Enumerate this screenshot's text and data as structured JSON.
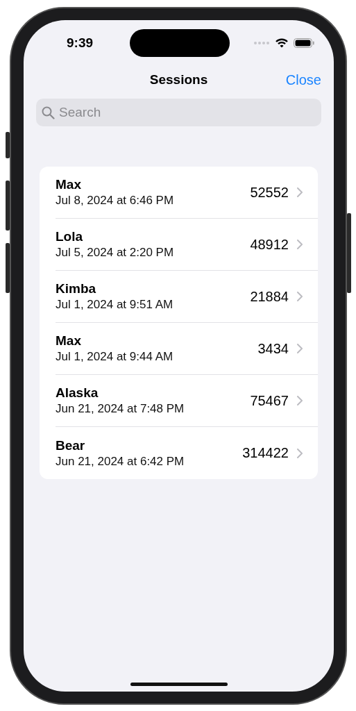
{
  "status_bar": {
    "time": "9:39"
  },
  "nav": {
    "title": "Sessions",
    "close": "Close"
  },
  "search": {
    "placeholder": "Search"
  },
  "sessions": [
    {
      "name": "Max",
      "date": "Jul 8, 2024 at 6:46 PM",
      "value": "52552"
    },
    {
      "name": "Lola",
      "date": "Jul 5, 2024 at 2:20 PM",
      "value": "48912"
    },
    {
      "name": "Kimba",
      "date": "Jul 1, 2024 at 9:51 AM",
      "value": "21884"
    },
    {
      "name": "Max",
      "date": "Jul 1, 2024 at 9:44 AM",
      "value": "3434"
    },
    {
      "name": "Alaska",
      "date": "Jun 21, 2024 at 7:48 PM",
      "value": "75467"
    },
    {
      "name": "Bear",
      "date": "Jun 21, 2024 at 6:42 PM",
      "value": "314422"
    }
  ]
}
